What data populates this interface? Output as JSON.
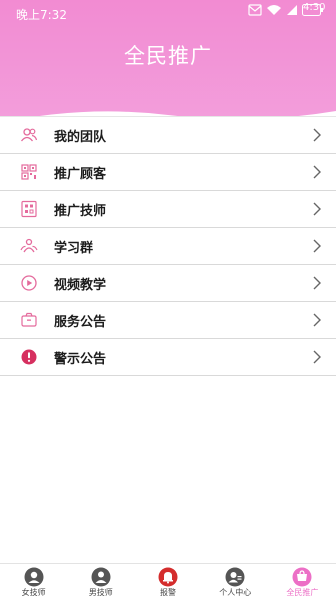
{
  "status_bar": {
    "time": "晚上7:32",
    "battery": "4:30"
  },
  "header": {
    "title": "全民推广",
    "gradient_top": "#f28bd2",
    "gradient_bottom": "#f3a1dd"
  },
  "menu": {
    "items": [
      {
        "label": "我的团队",
        "icon": "team-icon"
      },
      {
        "label": "推广顾客",
        "icon": "qr-code-icon"
      },
      {
        "label": "推广技师",
        "icon": "qr-code-icon"
      },
      {
        "label": "学习群",
        "icon": "group-icon"
      },
      {
        "label": "视频教学",
        "icon": "video-play-icon"
      },
      {
        "label": "服务公告",
        "icon": "notice-icon"
      },
      {
        "label": "警示公告",
        "icon": "warning-icon"
      }
    ]
  },
  "tabbar": {
    "active_color": "#ec6fc6",
    "tabs": [
      {
        "label": "女技师",
        "icon": "female-tech-icon"
      },
      {
        "label": "男技师",
        "icon": "male-tech-icon"
      },
      {
        "label": "报警",
        "icon": "alarm-bell-icon"
      },
      {
        "label": "个人中心",
        "icon": "profile-icon"
      },
      {
        "label": "全民推广",
        "icon": "promotion-icon",
        "active": true
      }
    ]
  }
}
